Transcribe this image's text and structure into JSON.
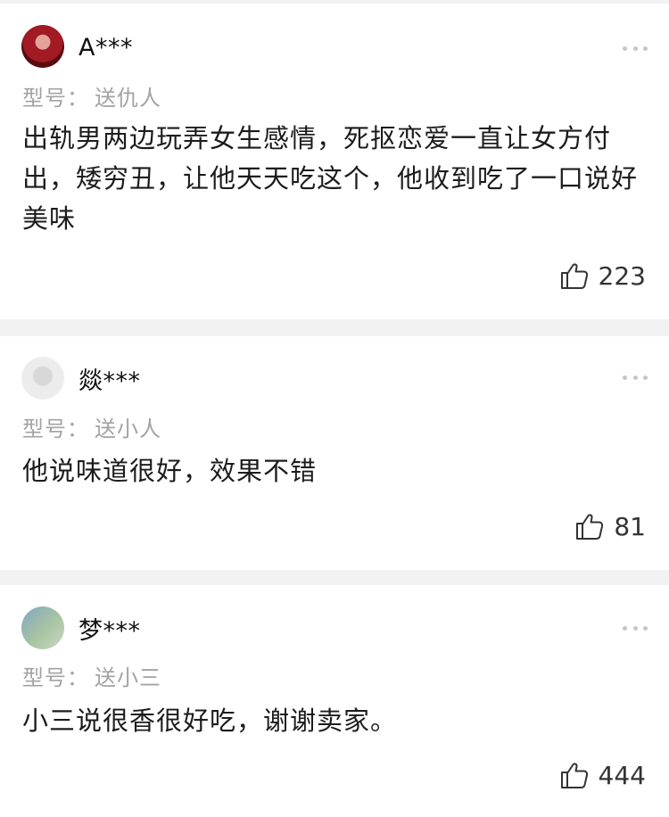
{
  "reviews": [
    {
      "username": "A***",
      "spec_label": "型号：",
      "spec_value": "送仇人",
      "content": "出轨男两边玩弄女生感情，死抠恋爱一直让女方付出，矮穷丑，让他天天吃这个，他收到吃了一口说好美味",
      "likes": "223"
    },
    {
      "username": "燚***",
      "spec_label": "型号：",
      "spec_value": "送小人",
      "content": "他说味道很好，效果不错",
      "likes": "81"
    },
    {
      "username": "梦***",
      "spec_label": "型号：",
      "spec_value": "送小三",
      "content": "小三说很香很好吃，谢谢卖家。",
      "likes": "444"
    }
  ],
  "icons": {
    "like": "thumbs-up-icon",
    "more": "more-dots-icon"
  }
}
